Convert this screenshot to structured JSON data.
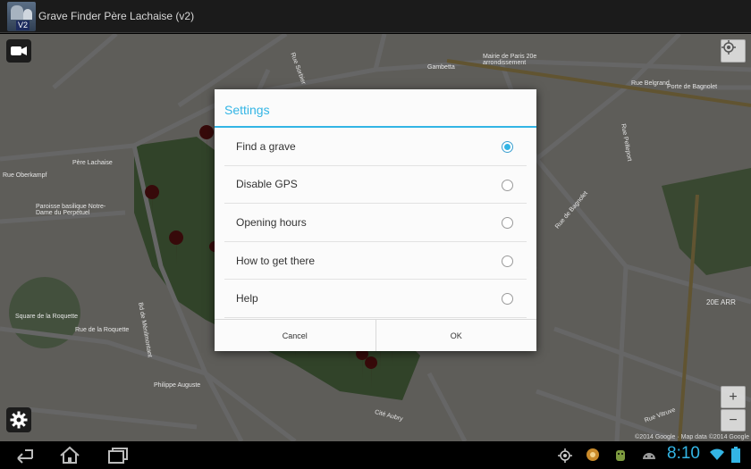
{
  "app": {
    "title": "Grave Finder Père Lachaise (v2)",
    "icon_badge": "V2"
  },
  "map": {
    "labels": [
      "Gambetta",
      "Mairie de Paris 20e arrondissement",
      "Rue Belgrand",
      "Porte de Bagnolet",
      "Père Lachaise",
      "Paroisse basilique Notre-Dame du Perpétuel",
      "Rue de la Roquette",
      "Square de la Roquette",
      "Philippe Auguste",
      "Bd de Ménilmontant",
      "Rue Pelleport",
      "Rue de Bagnolet",
      "Rue Vitruve",
      "20E ARR",
      "Rue Sorbier",
      "Rue Oberkampf",
      "Cité Aubry"
    ],
    "copyright": "©2014 Google · Map data ©2014 Google",
    "zoom_in": "+",
    "zoom_out": "−"
  },
  "dialog": {
    "title": "Settings",
    "options": [
      {
        "label": "Find a grave",
        "selected": true
      },
      {
        "label": "Disable GPS",
        "selected": false
      },
      {
        "label": "Opening hours",
        "selected": false
      },
      {
        "label": "How to get there",
        "selected": false
      },
      {
        "label": "Help",
        "selected": false
      }
    ],
    "cancel_label": "Cancel",
    "ok_label": "OK"
  },
  "status": {
    "time": "8:10"
  },
  "colors": {
    "accent": "#33b5e5",
    "marker": "#8b1a1a",
    "park": "#6f9b5a"
  }
}
